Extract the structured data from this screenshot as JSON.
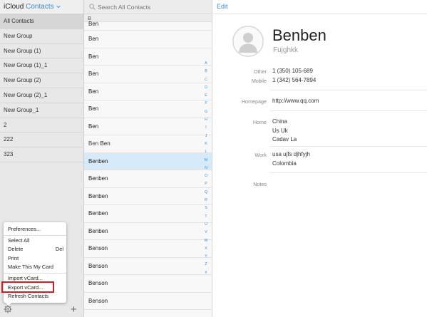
{
  "app": {
    "brand": "iCloud",
    "title": "Contacts"
  },
  "sidebar": {
    "groups": [
      "All Contacts",
      "New Group",
      "New Group (1)",
      "New Group (1)_1",
      "New Group (2)",
      "New Group (2)_1",
      "New Group_1",
      "2",
      "222",
      "323"
    ]
  },
  "menu": {
    "preferences": "Preferences...",
    "select_all": "Select All",
    "delete": "Delete",
    "delete_shortcut": "Del",
    "print": "Print",
    "make_my_card": "Make This My Card",
    "import_vcard": "Import vCard...",
    "export_vcard": "Export vCard...",
    "refresh": "Refresh Contacts"
  },
  "search": {
    "placeholder": "Search All Contacts"
  },
  "list": {
    "section": "B",
    "rows": [
      {
        "pre": "",
        "name": "Ben"
      },
      {
        "pre": "",
        "name": "Ben"
      },
      {
        "pre": "",
        "name": "Ben"
      },
      {
        "pre": "",
        "name": "Ben"
      },
      {
        "pre": "",
        "name": "Ben"
      },
      {
        "pre": "",
        "name": "Ben"
      },
      {
        "pre": "",
        "name": "Ben"
      },
      {
        "pre": "Ben",
        "name": "Ben"
      },
      {
        "pre": "",
        "name": "Benben"
      },
      {
        "pre": "",
        "name": "Benben"
      },
      {
        "pre": "",
        "name": "Benben"
      },
      {
        "pre": "",
        "name": "Benben"
      },
      {
        "pre": "",
        "name": "Benben"
      },
      {
        "pre": "",
        "name": "Benson"
      },
      {
        "pre": "",
        "name": "Benson"
      },
      {
        "pre": "",
        "name": "Benson"
      },
      {
        "pre": "",
        "name": "Benson"
      }
    ],
    "selected_index": 8
  },
  "index": [
    "A",
    "B",
    "C",
    "D",
    "E",
    "F",
    "G",
    "H",
    "I",
    "J",
    "K",
    "L",
    "M",
    "N",
    "O",
    "P",
    "Q",
    "R",
    "S",
    "T",
    "U",
    "V",
    "W",
    "X",
    "Y",
    "Z",
    "#"
  ],
  "detail": {
    "edit": "Edit",
    "name": "Benben",
    "subname": "Fujghkk",
    "other_label": "Other",
    "other_value": "1 (350) 105-689",
    "mobile_label": "Mobile",
    "mobile_value": "1 (342) 564-7894",
    "homepage_label": "Homepage",
    "homepage_value": "http://www.qq.com",
    "home_label": "Home",
    "home_lines": [
      "China",
      "Us Uk",
      "Cadav La"
    ],
    "work_label": "Work",
    "work_lines": [
      "usa ujfs djhfyjh",
      "Colombia"
    ],
    "notes_label": "Notes"
  },
  "colors": {
    "accent": "#2e8fe6",
    "selection": "#d6eafa",
    "highlight_box": "#cc1f1f"
  }
}
